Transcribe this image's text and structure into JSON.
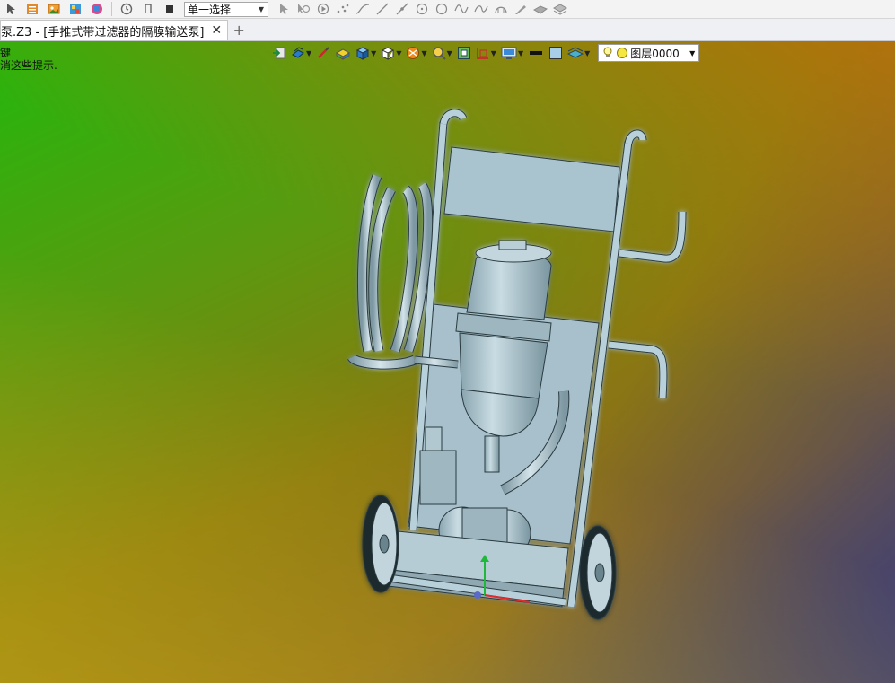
{
  "toolbar": {
    "selection_mode": "单一选择",
    "icons": [
      "arrow-icon",
      "list-icon",
      "image-icon",
      "palette-icon",
      "layers-icon",
      "clock-icon",
      "rewind-icon",
      "stop-icon"
    ],
    "tools": [
      "select-arrow-icon",
      "lasso-icon",
      "play-icon",
      "point-icon",
      "spline-icon",
      "line-icon",
      "segment-icon",
      "circle-target-icon",
      "circle-icon",
      "wave-icon",
      "curve-icon",
      "arc-icon",
      "pen-icon",
      "surface-icon",
      "layers-flat-icon"
    ]
  },
  "tabs": [
    {
      "label": "泵.Z3 - [手推式带过滤器的隔膜输送泵]",
      "close": "✕"
    }
  ],
  "new_tab": "+",
  "command_prompt": {
    "line1": "键",
    "line2": "消这些提示."
  },
  "view_toolbar": {
    "items": [
      "exit-icon",
      "render-mode-icon",
      "brush-icon",
      "color-cube-icon",
      "shaded-cube-icon",
      "wire-cube-icon",
      "filter-icon",
      "zoom-icon",
      "fit-view-icon",
      "section-icon",
      "display-icon",
      "line-weight-icon",
      "fill-color-icon",
      "layer-stack-icon"
    ],
    "layer": {
      "name": "图层0000",
      "bulb": "light-bulb-icon",
      "color": "#f5e642"
    }
  },
  "colors": {
    "model": "#a9c3cf",
    "model_edge": "#2a3a40"
  }
}
